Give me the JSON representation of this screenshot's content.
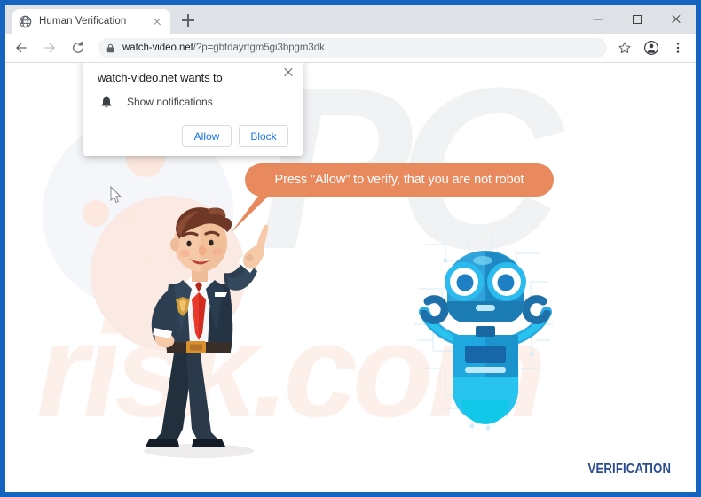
{
  "browser": {
    "tab": {
      "title": "Human Verification",
      "favicon_icon": "globe-icon",
      "close_icon": "close-icon"
    },
    "new_tab_icon": "plus-icon",
    "window_controls": {
      "minimize_icon": "minimize-icon",
      "maximize_icon": "maximize-icon",
      "close_icon": "close-icon"
    },
    "toolbar": {
      "back_icon": "arrow-left-icon",
      "forward_icon": "arrow-right-icon",
      "reload_icon": "reload-icon",
      "lock_icon": "lock-icon",
      "url_domain": "watch-video.net",
      "url_path": "/?p=gbtdayrtgm5gi3bpgm3dk",
      "bookmark_icon": "star-icon",
      "profile_icon": "account-avatar-icon",
      "menu_icon": "three-dots-menu-icon"
    }
  },
  "permission_popup": {
    "title": "watch-video.net wants to",
    "bell_icon": "bell-icon",
    "permission_label": "Show notifications",
    "allow_label": "Allow",
    "block_label": "Block",
    "close_icon": "close-icon"
  },
  "page": {
    "speech_bubble_text": "Press \"Allow\" to verify, that you are not robot",
    "watermark_top": "PC",
    "watermark_bottom": "risk.com",
    "verification_label": "VERIFICATION",
    "man_illustration": "businessman-pointing-illustration",
    "robot_illustration": "blue-robot-illustration",
    "cursor_icon": "mouse-cursor-icon"
  },
  "colors": {
    "window_frame": "#1565c0",
    "tabstrip": "#dee1e6",
    "link_blue": "#1a73e8",
    "bubble_orange": "#e98a5e",
    "verification_blue": "#2a4c8f",
    "robot_cyan": "#29b6e8",
    "suit_navy": "#273747",
    "tie_red": "#e8392a"
  }
}
